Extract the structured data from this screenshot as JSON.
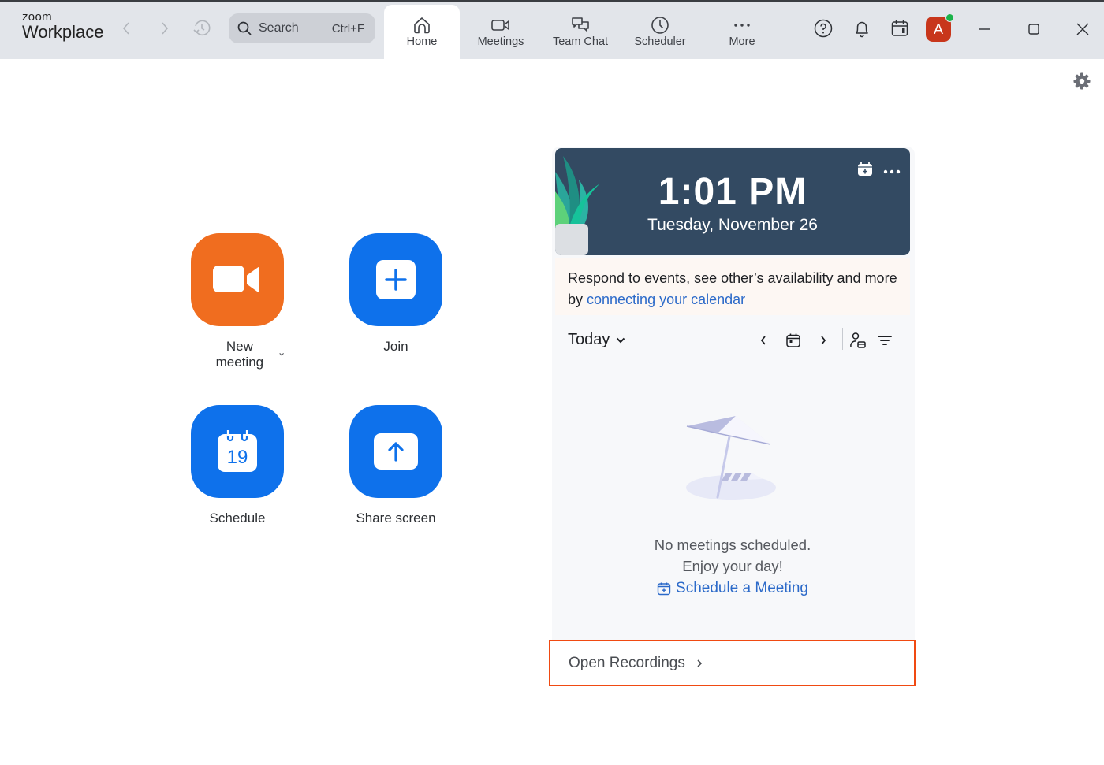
{
  "app": {
    "logo_small": "zoom",
    "logo_big": "Workplace"
  },
  "toolbar": {
    "search_placeholder": "Search",
    "search_shortcut": "Ctrl+F",
    "tabs": [
      {
        "label": "Home",
        "icon": "home-icon",
        "active": true
      },
      {
        "label": "Meetings",
        "icon": "video-camera-icon",
        "active": false
      },
      {
        "label": "Team Chat",
        "icon": "chat-icon",
        "active": false
      },
      {
        "label": "Scheduler",
        "icon": "clock-icon",
        "active": false
      },
      {
        "label": "More",
        "icon": "more-dots-icon",
        "active": false
      }
    ],
    "avatar_initial": "A",
    "avatar_color": "#c8361b",
    "presence_color": "#1bb34a"
  },
  "actions": [
    {
      "label": "New meeting",
      "icon": "video-camera-icon",
      "color": "#f06d1f",
      "has_dropdown": true
    },
    {
      "label": "Join",
      "icon": "plus-icon",
      "color": "#0e71eb"
    },
    {
      "label": "Schedule",
      "icon": "calendar-icon",
      "color": "#0e71eb",
      "calendar_day": "19"
    },
    {
      "label": "Share screen",
      "icon": "share-up-arrow-icon",
      "color": "#0e71eb"
    }
  ],
  "calendar_panel": {
    "time": "1:01 PM",
    "date": "Tuesday, November 26",
    "banner_text": "Respond to events, see other’s availability and more by ",
    "banner_link": "connecting your calendar",
    "view_label": "Today",
    "empty_line1": "No meetings scheduled.",
    "empty_line2": "Enjoy your day!",
    "schedule_link": "Schedule a Meeting",
    "open_recordings": "Open Recordings"
  },
  "colors": {
    "accent_blue": "#0e71eb",
    "accent_orange": "#f06d1f",
    "link": "#2c6ac9",
    "highlight_border": "#f04a12"
  }
}
